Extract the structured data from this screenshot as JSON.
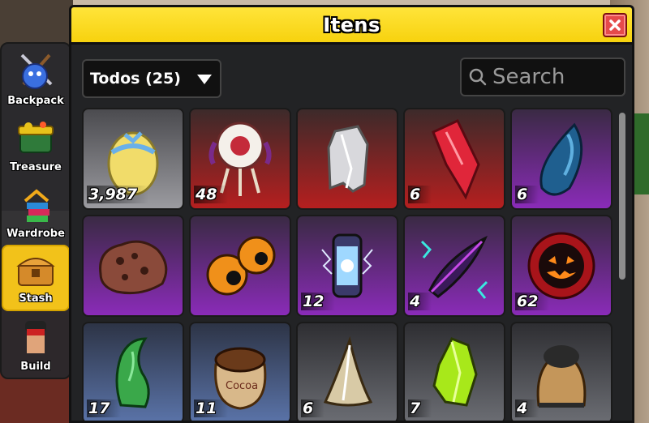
{
  "window": {
    "title": "Itens"
  },
  "sidebar": {
    "items": [
      {
        "label": "Backpack",
        "icon": "backpack-icon",
        "active": false
      },
      {
        "label": "Treasure",
        "icon": "treasure-icon",
        "active": false
      },
      {
        "label": "Wardrobe",
        "icon": "wardrobe-icon",
        "active": false
      },
      {
        "label": "Stash",
        "icon": "stash-icon",
        "active": true
      },
      {
        "label": "Build",
        "icon": "build-icon",
        "active": false
      }
    ]
  },
  "filter": {
    "label": "Todos (25)"
  },
  "search": {
    "placeholder": "Search"
  },
  "items": [
    {
      "name": "egg",
      "qty": "3,987",
      "rarity": "white"
    },
    {
      "name": "dreamcatcher",
      "qty": "48",
      "rarity": "red"
    },
    {
      "name": "crystal-shard",
      "qty": "",
      "rarity": "red"
    },
    {
      "name": "red-crystal",
      "qty": "6",
      "rarity": "red"
    },
    {
      "name": "blue-gem",
      "qty": "6",
      "rarity": "purple"
    },
    {
      "name": "rock-ore",
      "qty": "",
      "rarity": "purple"
    },
    {
      "name": "eyes",
      "qty": "",
      "rarity": "purple"
    },
    {
      "name": "lightning-jar",
      "qty": "12",
      "rarity": "purple"
    },
    {
      "name": "dark-feather",
      "qty": "4",
      "rarity": "purple"
    },
    {
      "name": "pumpkin-orb",
      "qty": "62",
      "rarity": "purple"
    },
    {
      "name": "green-claw",
      "qty": "17",
      "rarity": "blue"
    },
    {
      "name": "cocoa-sack",
      "qty": "11",
      "rarity": "blue"
    },
    {
      "name": "shark-tooth",
      "qty": "6",
      "rarity": "gray"
    },
    {
      "name": "green-crystal",
      "qty": "7",
      "rarity": "gray"
    },
    {
      "name": "hooded-cloak",
      "qty": "4",
      "rarity": "gray"
    }
  ],
  "colors": {
    "title_bar": "#f7d20e",
    "active_tab": "#f2c21a",
    "close": "#e54a4a"
  }
}
